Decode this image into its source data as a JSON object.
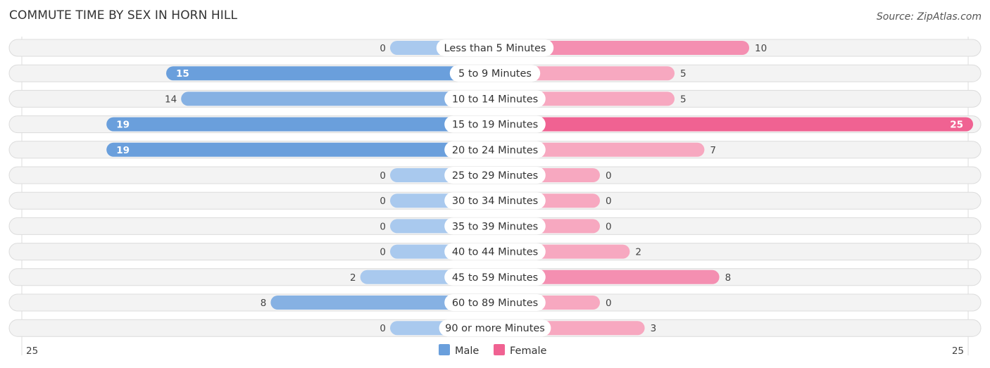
{
  "chart_data": {
    "type": "bar",
    "orientation": "horizontal-diverging",
    "title": "COMMUTE TIME BY SEX IN HORN HILL",
    "source": "Source: ZipAtlas.com",
    "categories": [
      "Less than 5 Minutes",
      "5 to 9 Minutes",
      "10 to 14 Minutes",
      "15 to 19 Minutes",
      "20 to 24 Minutes",
      "25 to 29 Minutes",
      "30 to 34 Minutes",
      "35 to 39 Minutes",
      "40 to 44 Minutes",
      "45 to 59 Minutes",
      "60 to 89 Minutes",
      "90 or more Minutes"
    ],
    "series": [
      {
        "name": "Male",
        "color": "#6a9fdc",
        "values": [
          0,
          15,
          14,
          19,
          19,
          0,
          0,
          0,
          0,
          2,
          8,
          0
        ]
      },
      {
        "name": "Female",
        "color": "#f06292",
        "values": [
          10,
          5,
          5,
          25,
          7,
          0,
          0,
          0,
          2,
          8,
          0,
          3
        ]
      }
    ],
    "axis": {
      "left_label": "25",
      "right_label": "25",
      "max": 25
    },
    "legend": {
      "position": "bottom-center",
      "items": [
        "Male",
        "Female"
      ]
    }
  }
}
